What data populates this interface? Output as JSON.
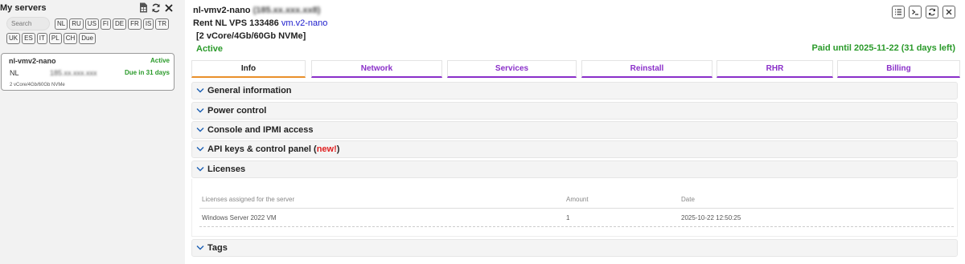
{
  "sidebar": {
    "title": "My servers",
    "search": {
      "placeholder": "Search",
      "value": ""
    },
    "filters_row1": [
      "NL",
      "RU",
      "US",
      "FI",
      "DE",
      "FR",
      "IS",
      "TR"
    ],
    "filters_row2": [
      "UK",
      "ES",
      "IT",
      "PL",
      "CH",
      "Due"
    ],
    "icons": [
      "spreadsheet-icon",
      "refresh-icon",
      "close-icon"
    ],
    "server_card": {
      "name": "nl-vmv2-nano",
      "status": "Active",
      "location": "NL",
      "ip": "185.xx.xxx.xxx",
      "due": "Due in 31 days",
      "spec": "2 vCore/4Gb/60Gb NVMe"
    }
  },
  "server": {
    "name": "nl-vmv2-nano",
    "ip_display": "(185.xx.xxx.xx8)",
    "plan_prefix": "Rent NL VPS 133486",
    "plan_link": "vm.v2-nano",
    "spec": "[2 vCore/4Gb/60Gb NVMe]",
    "state": "Active",
    "paid_until": "Paid until 2025-11-22 (31 days left)"
  },
  "top_actions": [
    "list-icon",
    "console-icon",
    "refresh-icon",
    "close-icon"
  ],
  "tabs": [
    {
      "label": "Info",
      "active": true
    },
    {
      "label": "Network",
      "active": false
    },
    {
      "label": "Services",
      "active": false
    },
    {
      "label": "Reinstall",
      "active": false
    },
    {
      "label": "RHR",
      "active": false
    },
    {
      "label": "Billing",
      "active": false
    }
  ],
  "sections": {
    "general": "General information",
    "power": "Power control",
    "console": "Console and IPMI access",
    "api": "API keys & control panel (",
    "api_new": "new!",
    "api_close": ")",
    "licenses": "Licenses",
    "tags": "Tags"
  },
  "licenses_table": {
    "headers": [
      "Licenses assigned for the server",
      "Amount",
      "Date"
    ],
    "rows": [
      [
        "Windows Server 2022 VM",
        "1",
        "2025-10-22 12:50:25"
      ]
    ]
  },
  "colors": {
    "accent_purple": "#8a2fc9",
    "active_tab_orange": "#e9902a",
    "status_green": "#2a9a2a",
    "link_blue": "#1a1acc",
    "new_red": "#e02020"
  }
}
